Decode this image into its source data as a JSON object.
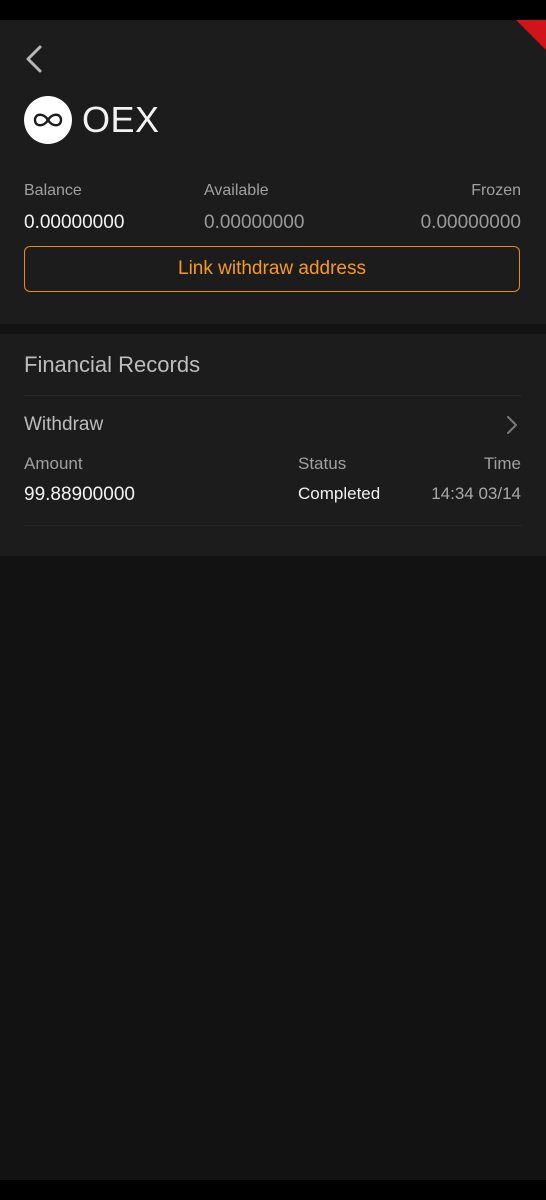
{
  "header": {
    "back_icon": "chevron-left-icon",
    "coin_name": "OEX",
    "coin_logo_icon": "infinity-icon"
  },
  "balances": {
    "balance_label": "Balance",
    "balance_value": "0.00000000",
    "available_label": "Available",
    "available_value": "0.00000000",
    "frozen_label": "Frozen",
    "frozen_value": "0.00000000"
  },
  "link_button": {
    "label": "Link withdraw address"
  },
  "records": {
    "title": "Financial Records",
    "items": [
      {
        "type": "Withdraw",
        "amount_label": "Amount",
        "amount": "99.88900000",
        "status_label": "Status",
        "status": "Completed",
        "time_label": "Time",
        "time": "14:34 03/14"
      }
    ]
  },
  "colors": {
    "accent": "#f39a28",
    "background": "#121212",
    "card": "#1c1c1c",
    "flag": "#d1131a"
  }
}
